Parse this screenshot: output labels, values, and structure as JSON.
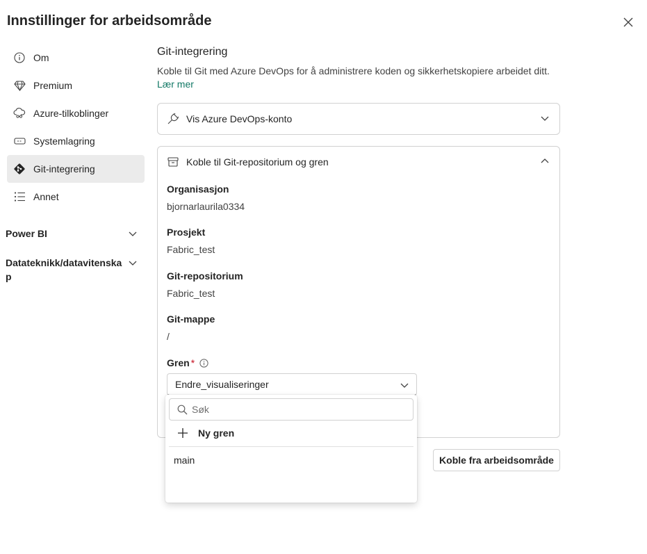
{
  "dialog": {
    "title": "Innstillinger for arbeidsområde",
    "close_icon": "close-icon"
  },
  "sidebar": {
    "items": [
      {
        "label": "Om",
        "icon": "info-icon",
        "active": false
      },
      {
        "label": "Premium",
        "icon": "diamond-icon",
        "active": false
      },
      {
        "label": "Azure-tilkoblinger",
        "icon": "cloud-link-icon",
        "active": false
      },
      {
        "label": "Systemlagring",
        "icon": "storage-icon",
        "active": false
      },
      {
        "label": "Git-integrering",
        "icon": "git-icon",
        "active": true
      },
      {
        "label": "Annet",
        "icon": "list-icon",
        "active": false
      }
    ],
    "groups": [
      {
        "label": "Power BI",
        "icon": "chevron-down-icon"
      },
      {
        "label": "Datateknikk/datavitenskap",
        "icon": "chevron-down-icon"
      }
    ]
  },
  "main": {
    "title": "Git-integrering",
    "description": "Koble til Git med Azure DevOps for å administrere koden og sikkerhetskopiere arbeidet ditt.",
    "learn_more": "Lær mer",
    "account_card": {
      "label": "Vis Azure DevOps-konto",
      "icon": "plug-icon",
      "expanded": false
    },
    "repo_card": {
      "label": "Koble til Git-repositorium og gren",
      "icon": "archive-icon",
      "expanded": true,
      "fields": [
        {
          "label": "Organisasjon",
          "value": "bjornarlaurila0334"
        },
        {
          "label": "Prosjekt",
          "value": "Fabric_test"
        },
        {
          "label": "Git-repositorium",
          "value": "Fabric_test"
        },
        {
          "label": "Git-mappe",
          "value": "/"
        }
      ],
      "branch": {
        "label": "Gren",
        "required_mark": "*",
        "selected": "Endre_visualiseringer"
      }
    },
    "disconnect_button": "Koble fra arbeidsområde"
  },
  "branch_popup": {
    "search_placeholder": "Søk",
    "new_branch_label": "Ny gren",
    "options": [
      "main"
    ]
  },
  "colors": {
    "accent_link": "#117865",
    "required": "#c50f1f",
    "active_bg": "#ebebeb"
  }
}
